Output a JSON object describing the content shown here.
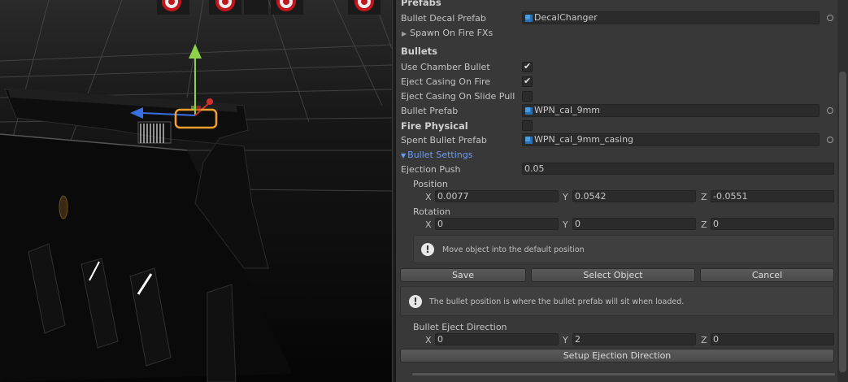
{
  "inspector": {
    "section_prefabs": "Prefabs",
    "bullet_decal_prefab": {
      "label": "Bullet Decal Prefab",
      "value": "DecalChanger"
    },
    "spawn_on_fire_fxs": "Spawn On Fire FXs",
    "section_bullets": "Bullets",
    "use_chamber_bullet": {
      "label": "Use Chamber Bullet",
      "checked": true
    },
    "eject_casing_on_fire": {
      "label": "Eject Casing On Fire",
      "checked": true
    },
    "eject_casing_on_slide_pull": {
      "label": "Eject Casing On Slide Pull",
      "checked": false
    },
    "bullet_prefab": {
      "label": "Bullet Prefab",
      "value": "WPN_cal_9mm"
    },
    "fire_physical": {
      "label": "Fire Physical",
      "checked": false
    },
    "spent_bullet_prefab": {
      "label": "Spent Bullet Prefab",
      "value": "WPN_cal_9mm_casing"
    },
    "bullet_settings": "Bullet Settings",
    "ejection_push": {
      "label": "Ejection Push",
      "value": "0.05"
    },
    "position": {
      "label": "Position",
      "x": "0.0077",
      "y": "0.0542",
      "z": "-0.0551"
    },
    "rotation": {
      "label": "Rotation",
      "x": "0",
      "y": "0",
      "z": "0"
    },
    "axis": {
      "x": "X",
      "y": "Y",
      "z": "Z"
    },
    "help_move": "Move object into the default position",
    "buttons": {
      "save": "Save",
      "select_object": "Select Object",
      "cancel": "Cancel"
    },
    "help_bullet_position": "The bullet position is where the bullet prefab will sit when loaded.",
    "bullet_eject_direction": {
      "label": "Bullet Eject Direction",
      "x": "0",
      "y": "2",
      "z": "0"
    },
    "setup_ejection_direction": "Setup Ejection Direction",
    "icons": {
      "object": "prefab-cube-icon",
      "picker": "object-picker-icon",
      "info": "info-icon"
    }
  },
  "colors": {
    "accent_blue": "#6d9bf0",
    "panel": "#383838",
    "field": "#2b2b2b",
    "target_red": "#c0171d"
  }
}
